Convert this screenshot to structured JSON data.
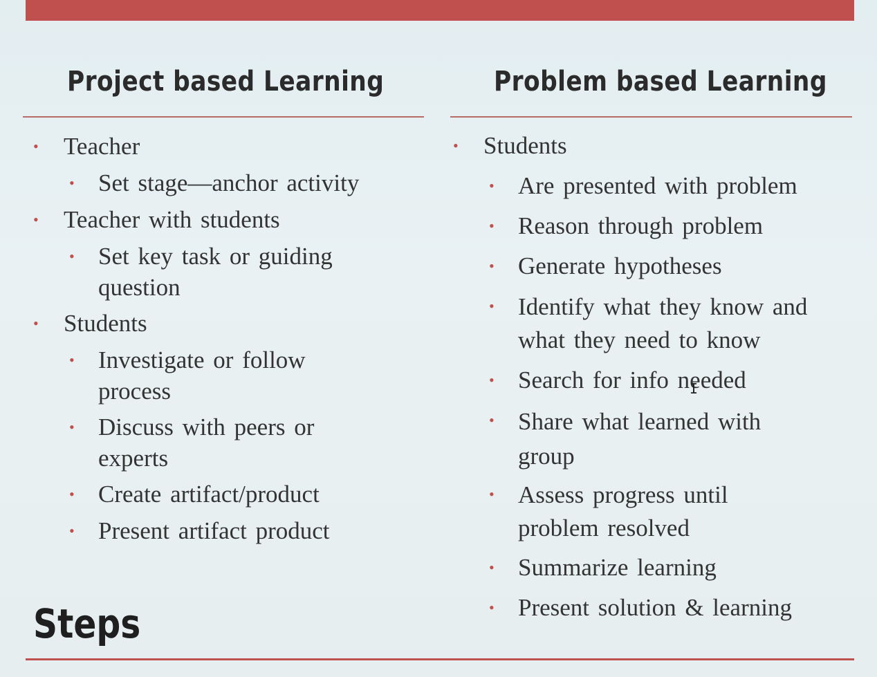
{
  "headings": {
    "left": "Project based Learning",
    "right": "Problem based Learning"
  },
  "left_list": [
    {
      "text": "Teacher",
      "level": 1
    },
    {
      "text": "Set stage—anchor activity",
      "level": 2
    },
    {
      "text": "Teacher with students",
      "level": 1
    },
    {
      "text": "Set key task or guiding question",
      "level": 2
    },
    {
      "text": "Students",
      "level": 1
    },
    {
      "text": "Investigate or follow process",
      "level": 2
    },
    {
      "text": "Discuss with peers or experts",
      "level": 2
    },
    {
      "text": "Create artifact/product",
      "level": 2
    },
    {
      "text": "Present artifact product",
      "level": 2
    }
  ],
  "right_list": [
    {
      "text": "Students",
      "level": 1
    },
    {
      "text": "Are presented with problem",
      "level": 2
    },
    {
      "text": "Reason through problem",
      "level": 2
    },
    {
      "text": "Generate hypotheses",
      "level": 2
    },
    {
      "text": "Identify what they know and what they need to know",
      "level": 2
    },
    {
      "text": "Search for info needed",
      "level": 2
    },
    {
      "text": "Share what learned with group",
      "level": 2
    },
    {
      "text": "Assess progress until problem resolved",
      "level": 2
    },
    {
      "text": "Summarize learning",
      "level": 2
    },
    {
      "text": "Present solution & learning",
      "level": 2
    }
  ],
  "footer_title": "Steps",
  "bullet_glyph": "•",
  "colors": {
    "accent": "#c0504d",
    "text": "#333333"
  }
}
